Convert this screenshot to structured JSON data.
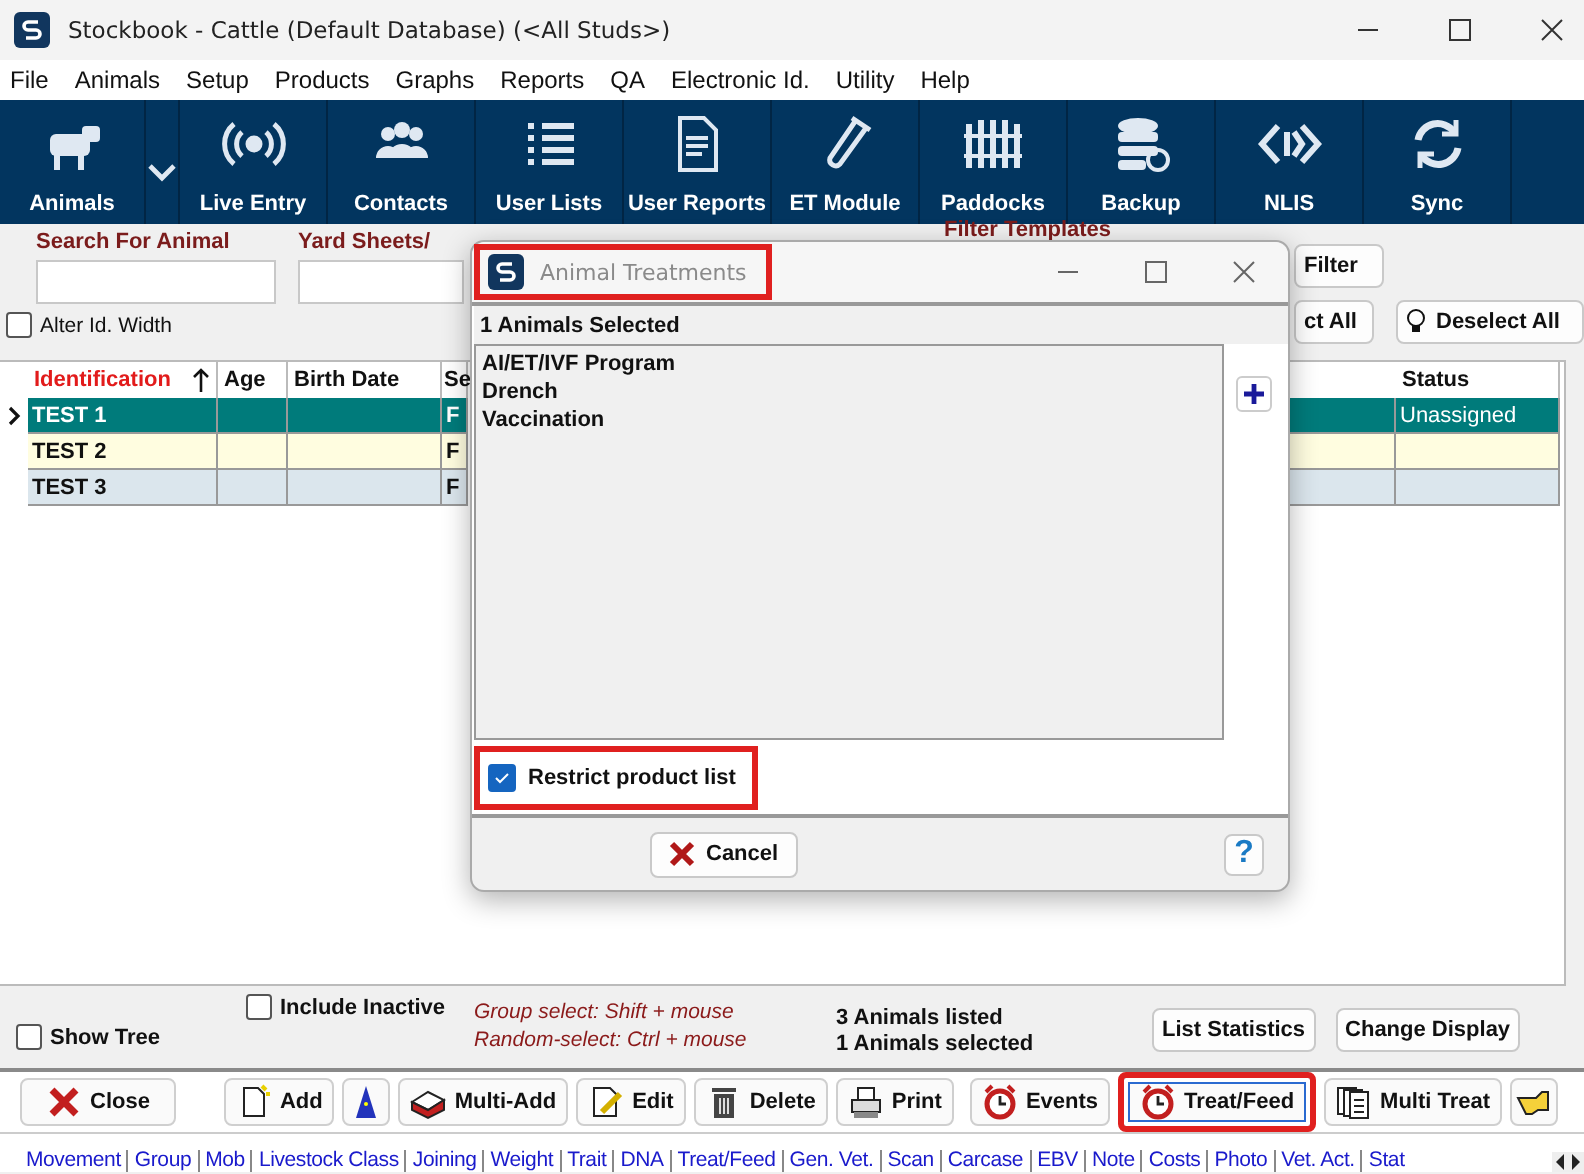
{
  "window": {
    "title": "Stockbook - Cattle (Default Database) (<All Studs>)"
  },
  "menu": [
    "File",
    "Animals",
    "Setup",
    "Products",
    "Graphs",
    "Reports",
    "QA",
    "Electronic Id.",
    "Utility",
    "Help"
  ],
  "toolbar": [
    {
      "kind": "button",
      "label": "Animals"
    },
    {
      "kind": "dropdown"
    },
    {
      "kind": "button",
      "label": "Live Entry"
    },
    {
      "kind": "button",
      "label": "Contacts"
    },
    {
      "kind": "button",
      "label": "User Lists"
    },
    {
      "kind": "button",
      "label": "User Reports"
    },
    {
      "kind": "button",
      "label": "ET Module"
    },
    {
      "kind": "button",
      "label": "Paddocks"
    },
    {
      "kind": "button",
      "label": "Backup"
    },
    {
      "kind": "button",
      "label": "NLIS"
    },
    {
      "kind": "button",
      "label": "Sync"
    }
  ],
  "search": {
    "label": "Search For Animal"
  },
  "yard_sheets": {
    "label": "Yard Sheets/"
  },
  "filter_templates": {
    "label": "Filter Templates"
  },
  "alter_id_width": {
    "label": "Alter Id. Width",
    "checked": false
  },
  "filter_buttons": [
    "Filter",
    "ct All",
    "Deselect All"
  ],
  "table": {
    "columns": [
      "Identification",
      "Age",
      "Birth Date",
      "Se",
      "Status"
    ],
    "rows": [
      {
        "identification": "TEST 1",
        "column_4": "F",
        "status": "Unassigned",
        "selected": true
      },
      {
        "identification": "TEST 2",
        "column_4": "F",
        "selected": false
      },
      {
        "identification": "TEST 3",
        "column_4": "F",
        "selected": false
      }
    ]
  },
  "include_inactive": {
    "label": "Include Inactive",
    "checked": false
  },
  "show_tree": {
    "label": "Show Tree",
    "checked": false
  },
  "hints": [
    "Group select: Shift + mouse",
    "Random-select: Ctrl + mouse"
  ],
  "counts": [
    "3 Animals listed",
    "1 Animals selected"
  ],
  "side_buttons": [
    "List Statistics",
    "Change Display"
  ],
  "actions": [
    {
      "kind": "text",
      "label": "Close",
      "focused": false,
      "highlighted": false
    },
    {
      "kind": "text",
      "label": "Add",
      "focused": false,
      "highlighted": false
    },
    {
      "kind": "icon",
      "focused": false,
      "highlighted": false
    },
    {
      "kind": "text",
      "label": "Multi-Add",
      "focused": false,
      "highlighted": false
    },
    {
      "kind": "text",
      "label": "Edit",
      "focused": false,
      "highlighted": false
    },
    {
      "kind": "text",
      "label": "Delete",
      "focused": false,
      "highlighted": false
    },
    {
      "kind": "text",
      "label": "Print",
      "focused": false,
      "highlighted": false
    },
    {
      "kind": "text",
      "label": "Events",
      "focused": false,
      "highlighted": false
    },
    {
      "kind": "text",
      "label": "Treat/Feed",
      "focused": true,
      "highlighted": true
    },
    {
      "kind": "text",
      "label": "Multi Treat",
      "focused": false,
      "highlighted": false
    },
    {
      "kind": "icon",
      "focused": false,
      "highlighted": false
    }
  ],
  "links": [
    "Movement",
    "Group",
    "Mob",
    "Livestock Class",
    "Joining",
    "Weight",
    "Trait",
    "DNA",
    "Treat/Feed",
    "Gen. Vet.",
    "Scan",
    "Carcase",
    "EBV",
    "Note",
    "Costs",
    "Photo",
    "Vet. Act.",
    "Stat"
  ],
  "dialog": {
    "title": "Animal Treatments",
    "title_highlighted": true,
    "selected_count": "1 Animals Selected",
    "items": [
      "AI/ET/IVF Program",
      "Drench",
      "Vaccination"
    ],
    "restrict": {
      "label": "Restrict product list",
      "checked": true,
      "highlighted": true
    },
    "cancel": "Cancel",
    "help": "?"
  }
}
